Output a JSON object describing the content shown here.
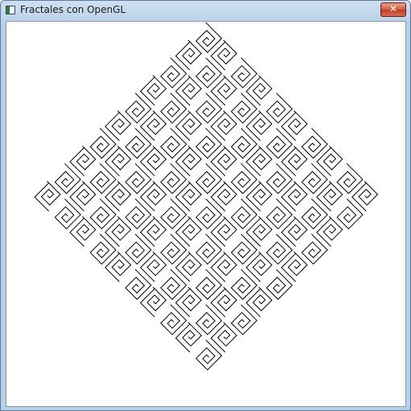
{
  "window": {
    "title": "Fractales con OpenGL",
    "close_label": "✕"
  },
  "canvas": {
    "background": "#ffffff",
    "stroke_color": "#000000"
  }
}
